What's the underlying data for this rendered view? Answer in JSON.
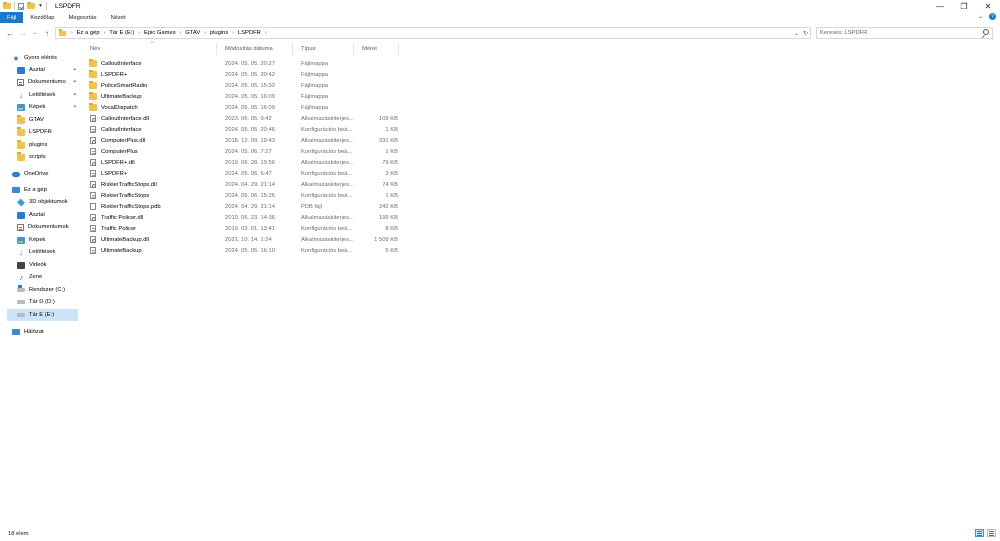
{
  "window": {
    "title": "LSPDFR",
    "qa_icons": [
      "folder-icon",
      "properties-icon",
      "new-folder-icon",
      "dropdown-icon"
    ],
    "controls": {
      "minimize": "—",
      "maximize": "❐",
      "close": "✕"
    }
  },
  "ribbon": {
    "tabs": [
      {
        "label": "Fájl",
        "active": true
      },
      {
        "label": "Kezdőlap",
        "active": false
      },
      {
        "label": "Megosztás",
        "active": false
      },
      {
        "label": "Nézet",
        "active": false
      }
    ],
    "chevron": "⌄",
    "help": "?"
  },
  "address": {
    "back": "←",
    "forward": "→",
    "recent": "⌄",
    "up": "↑",
    "breadcrumbs": [
      "Ez a gép",
      "Tár E (E:)",
      "Epic Games",
      "GTAV",
      "plugins",
      "LSPDFR"
    ],
    "separator": "›",
    "dropdown": "⌄",
    "refresh": "↻"
  },
  "search": {
    "placeholder": "Keresés: LSPDFR"
  },
  "sidebar": {
    "items": [
      {
        "label": "Gyors elérés",
        "icon": "star-icon",
        "pinned": false,
        "selected": false
      },
      {
        "label": "Asztal",
        "icon": "desktop-icon",
        "pinned": true,
        "selected": false
      },
      {
        "label": "Dokumentumo",
        "icon": "documents-icon",
        "pinned": true,
        "selected": false
      },
      {
        "label": "Letöltések",
        "icon": "downloads-icon",
        "pinned": true,
        "selected": false
      },
      {
        "label": "Képek",
        "icon": "pictures-icon",
        "pinned": true,
        "selected": false
      },
      {
        "label": "GTAV",
        "icon": "folder-icon",
        "pinned": false,
        "selected": false
      },
      {
        "label": "LSPDFR",
        "icon": "folder-icon",
        "pinned": false,
        "selected": false
      },
      {
        "label": "plugins",
        "icon": "folder-icon",
        "pinned": false,
        "selected": false
      },
      {
        "label": "scripts",
        "icon": "folder-icon",
        "pinned": false,
        "selected": false
      },
      {
        "label": "OneDrive",
        "icon": "onedrive-icon",
        "pinned": false,
        "selected": false
      },
      {
        "label": "Ez a gép",
        "icon": "computer-icon",
        "pinned": false,
        "selected": false
      },
      {
        "label": "3D objektumok",
        "icon": "3d-objects-icon",
        "pinned": false,
        "selected": false
      },
      {
        "label": "Asztal",
        "icon": "desktop-icon",
        "pinned": false,
        "selected": false
      },
      {
        "label": "Dokumentumok",
        "icon": "documents-icon",
        "pinned": false,
        "selected": false
      },
      {
        "label": "Képek",
        "icon": "pictures-icon",
        "pinned": false,
        "selected": false
      },
      {
        "label": "Letöltések",
        "icon": "downloads-icon",
        "pinned": false,
        "selected": false
      },
      {
        "label": "Videók",
        "icon": "videos-icon",
        "pinned": false,
        "selected": false
      },
      {
        "label": "Zene",
        "icon": "music-icon",
        "pinned": false,
        "selected": false
      },
      {
        "label": "Rendszer (C:)",
        "icon": "windows-drive-icon",
        "pinned": false,
        "selected": false
      },
      {
        "label": "Tár D (D:)",
        "icon": "drive-icon",
        "pinned": false,
        "selected": false
      },
      {
        "label": "Tár E  (E:)",
        "icon": "drive-icon",
        "pinned": false,
        "selected": true
      },
      {
        "label": "Hálózat",
        "icon": "network-icon",
        "pinned": false,
        "selected": false
      }
    ],
    "pin_glyph": "📌"
  },
  "columns": {
    "name": "Név",
    "date": "Módosítás dátuma",
    "type": "Típus",
    "size": "Méret",
    "sort_glyph": "^"
  },
  "files": [
    {
      "name": "CalloutInterface",
      "date": "2024. 05. 05. 20:27",
      "type": "Fájlmappa",
      "size": "",
      "icon": "folder-icon"
    },
    {
      "name": "LSPDFR+",
      "date": "2024. 05. 05. 20:42",
      "type": "Fájlmappa",
      "size": "",
      "icon": "folder-icon"
    },
    {
      "name": "PoliceSmartRadio",
      "date": "2024. 05. 05. 15:32",
      "type": "Fájlmappa",
      "size": "",
      "icon": "folder-icon"
    },
    {
      "name": "UltimateBackup",
      "date": "2024. 05. 05. 16:09",
      "type": "Fájlmappa",
      "size": "",
      "icon": "folder-icon"
    },
    {
      "name": "VocalDispatch",
      "date": "2024. 05. 05. 16:09",
      "type": "Fájlmappa",
      "size": "",
      "icon": "folder-icon"
    },
    {
      "name": "CalloutInterface.dll",
      "date": "2023. 06. 05. 9:42",
      "type": "Alkalmazáskiterjes...",
      "size": "109 KB",
      "icon": "dll-file-icon"
    },
    {
      "name": "CalloutInterface",
      "date": "2024. 05. 05. 20:46",
      "type": "Konfigurációs beá...",
      "size": "1 KB",
      "icon": "config-file-icon"
    },
    {
      "name": "ComputerPlus.dll",
      "date": "2018. 12. 09. 19:43",
      "type": "Alkalmazáskiterjes...",
      "size": "331 KB",
      "icon": "dll-file-icon"
    },
    {
      "name": "ComputerPlus",
      "date": "2024. 05. 06. 7:27",
      "type": "Konfigurációs beá...",
      "size": "1 KB",
      "icon": "config-file-icon"
    },
    {
      "name": "LSPDFR+.dll",
      "date": "2019. 06. 28. 19:56",
      "type": "Alkalmazáskiterjes...",
      "size": "79 KB",
      "icon": "dll-file-icon"
    },
    {
      "name": "LSPDFR+",
      "date": "2024. 05. 06. 6:47",
      "type": "Konfigurációs beá...",
      "size": "3 KB",
      "icon": "config-file-icon"
    },
    {
      "name": "RiskierTrafficStops.dll",
      "date": "2024. 04. 29. 21:14",
      "type": "Alkalmazáskiterjes...",
      "size": "74 KB",
      "icon": "dll-file-icon"
    },
    {
      "name": "RiskierTrafficStops",
      "date": "2024. 05. 06. 15:26",
      "type": "Konfigurációs beá...",
      "size": "1 KB",
      "icon": "config-file-icon"
    },
    {
      "name": "RiskierTrafficStops.pdb",
      "date": "2024. 04. 29. 21:14",
      "type": "PDB fájl",
      "size": "242 KB",
      "icon": "pdb-file-icon"
    },
    {
      "name": "Traffic Policer.dll",
      "date": "2019. 06. 23. 14:36",
      "type": "Alkalmazáskiterjes...",
      "size": "199 KB",
      "icon": "dll-file-icon"
    },
    {
      "name": "Traffic Policer",
      "date": "2019. 03. 01. 13:41",
      "type": "Konfigurációs beá...",
      "size": "8 KB",
      "icon": "config-file-icon"
    },
    {
      "name": "UltimateBackup.dll",
      "date": "2021. 10. 14. 1:24",
      "type": "Alkalmazáskiterjes...",
      "size": "1 509 KB",
      "icon": "dll-file-icon"
    },
    {
      "name": "UltimateBackup",
      "date": "2024. 05. 05. 16:10",
      "type": "Konfigurációs beá...",
      "size": "5 KB",
      "icon": "config-file-icon"
    }
  ],
  "status": {
    "count": "18 elem"
  },
  "colors": {
    "accent": "#1979ca",
    "selection": "#cce4f7",
    "folder": "#f2c24b",
    "header_text": "#4c607a",
    "meta_text": "#6d6d6d"
  }
}
